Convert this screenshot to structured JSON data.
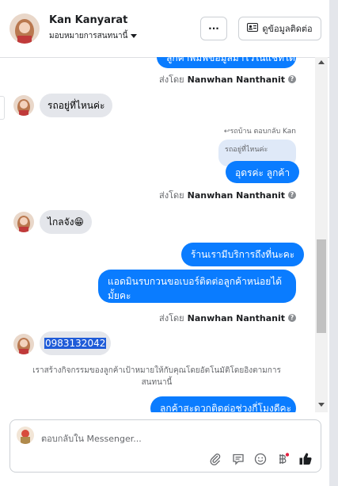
{
  "header": {
    "name": "Kan Kanyarat",
    "assign": "มอบหมายการสนทนานี้",
    "more_label": "···",
    "view_contact_label": "ดูข้อมูลติดต่อ"
  },
  "messages": {
    "top_cut_text": "ลูกค้าพิมพ์ข้อมูลมาไว้ในแชทได้เลยค่ะ",
    "sent_by_prefix": "ส่งโดย",
    "sender": "Nanwhan Nanthanit",
    "in_1": "รถอยู่ที่ไหนค่ะ",
    "reply_note": "↩รถบ้าน ตอบกลับ Kan",
    "quoted": "รถอยู่ที่ไหนค่ะ",
    "out_1": "อุดรค่ะ ลูกค้า",
    "in_2": "ไกลจัง😁",
    "out_2": "ร้านเรามีบริการถึงที่นะคะ",
    "out_3": "แอดมินรบกวนขอเบอร์ติดต่อลูกค้าหน่อยได้มั้ยคะ",
    "in_3": "0983132042",
    "system": "เราสร้างกิจกรรมของลูกค้าเป้าหมายให้กับคุณโดยอัตโนมัติโดยอิงตามการสนทนานี้",
    "bottom_cut_text": "ลูกค้าสะดวกติดต่อช่วงกี่โมงดีคะ"
  },
  "composer": {
    "placeholder": "ตอบกลับใน Messenger..."
  },
  "icons": [
    "more-icon",
    "contact-card-icon",
    "paperclip-icon",
    "saved-replies-icon",
    "emoji-icon",
    "currency-icon",
    "like-icon",
    "help-icon"
  ],
  "colors": {
    "accent": "#0a7cff",
    "bubble_in": "#e4e6eb",
    "highlight": "#1f5bd8"
  }
}
